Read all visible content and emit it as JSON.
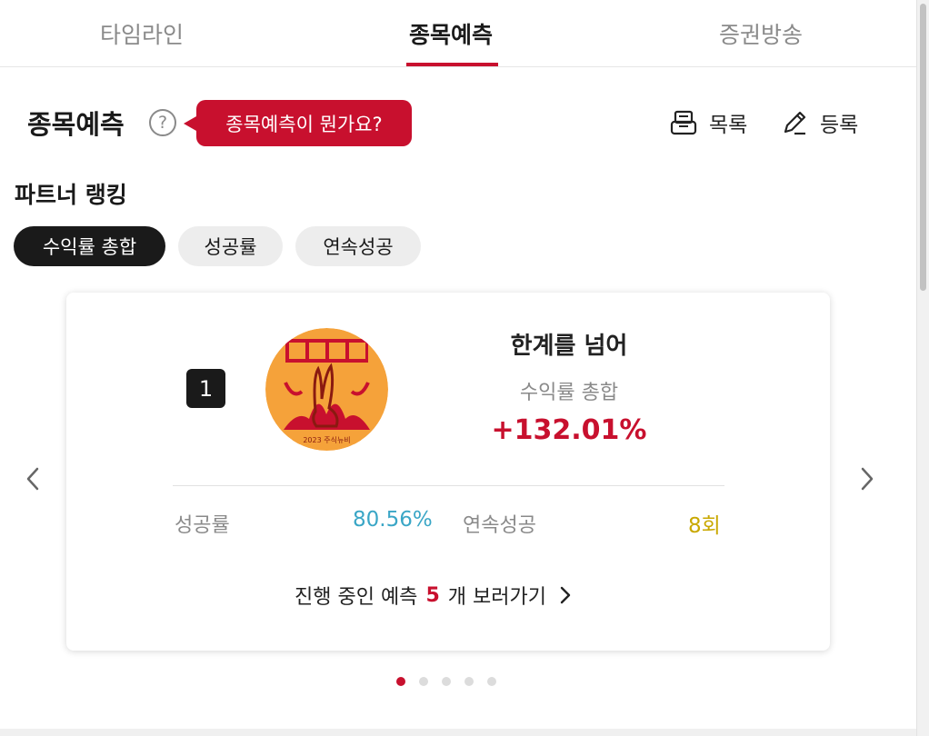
{
  "tabs": [
    {
      "label": "타임라인"
    },
    {
      "label": "종목예측"
    },
    {
      "label": "증권방송"
    }
  ],
  "section": {
    "title": "종목예측",
    "help_icon": "?",
    "tooltip": "종목예측이 뭔가요?",
    "list_label": "목록",
    "register_label": "등록"
  },
  "ranking": {
    "title": "파트너 랭킹",
    "filters": [
      {
        "label": "수익률 총합",
        "active": true
      },
      {
        "label": "성공률",
        "active": false
      },
      {
        "label": "연속성공",
        "active": false
      }
    ]
  },
  "card": {
    "rank": "1",
    "name": "한계를 넘어",
    "metric_label": "수익률 총합",
    "metric_value": "+132.01%",
    "success_rate_label": "성공률",
    "success_rate_value": "80.56%",
    "streak_label": "연속성공",
    "streak_value": "8회",
    "goto_prefix": "진행 중인 예측",
    "goto_count": "5",
    "goto_suffix": "개 보러가기",
    "avatar_caption": "2023 주식뉴비"
  },
  "pagination": {
    "total": 5,
    "current": 1
  },
  "colors": {
    "accent": "#c8102e",
    "success_rate": "#3aa6c6",
    "streak": "#c9a800",
    "chip_active_bg": "#1a1a1a",
    "chip_bg": "#ededed"
  },
  "icons": {
    "help": "question-circle-icon",
    "list": "tray-list-icon",
    "register": "pencil-icon",
    "prev": "chevron-left-icon",
    "next": "chevron-right-icon",
    "goto": "chevron-right-icon"
  }
}
